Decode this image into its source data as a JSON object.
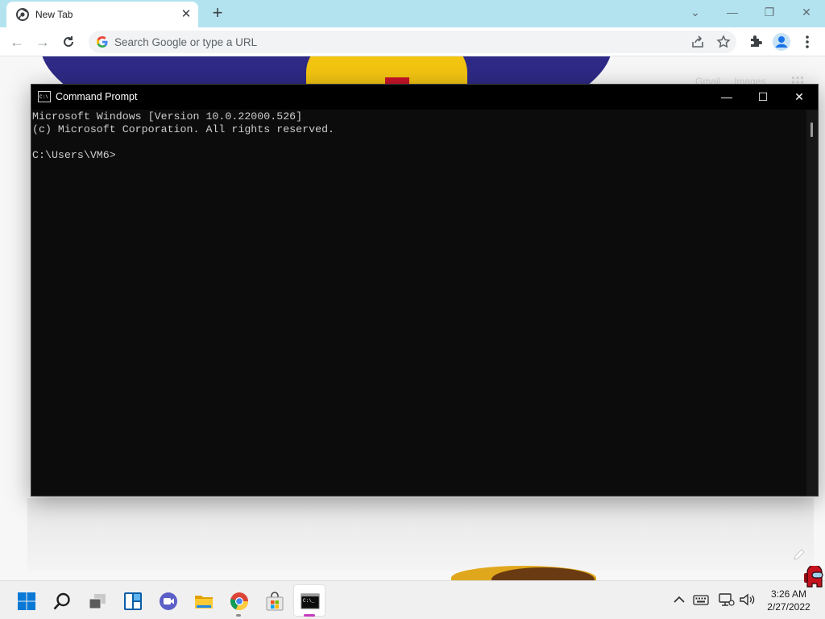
{
  "browser": {
    "tab_title": "New Tab",
    "omnibox_placeholder": "Search Google or type a URL",
    "icons": [
      "chrome-icon",
      "close-icon",
      "plus-icon",
      "chevron-down-icon",
      "minimize-icon",
      "restore-icon",
      "close-icon",
      "back-icon",
      "forward-icon",
      "reload-icon",
      "google-icon",
      "share-icon",
      "star-icon",
      "extensions-icon",
      "profile-icon",
      "menu-icon"
    ]
  },
  "ntp": {
    "link_gmail": "Gmail",
    "link_images": "Images"
  },
  "cmd": {
    "title": "Command Prompt",
    "output": "Microsoft Windows [Version 10.0.22000.526]\n(c) Microsoft Corporation. All rights reserved.\n\nC:\\Users\\VM6>"
  },
  "taskbar": {
    "apps": [
      "Start",
      "Search",
      "Task View",
      "Widgets",
      "Chat",
      "File Explorer",
      "Google Chrome",
      "Microsoft Store",
      "Command Prompt"
    ],
    "time": "3:26 AM",
    "date": "2/27/2022"
  },
  "colors": {
    "tabstrip": "#b4e3f0",
    "cmd_bg": "#0c0c0c",
    "cmd_text": "#cccccc",
    "taskbar": "#f0f0f0",
    "windows_blue": "#0078d4"
  }
}
